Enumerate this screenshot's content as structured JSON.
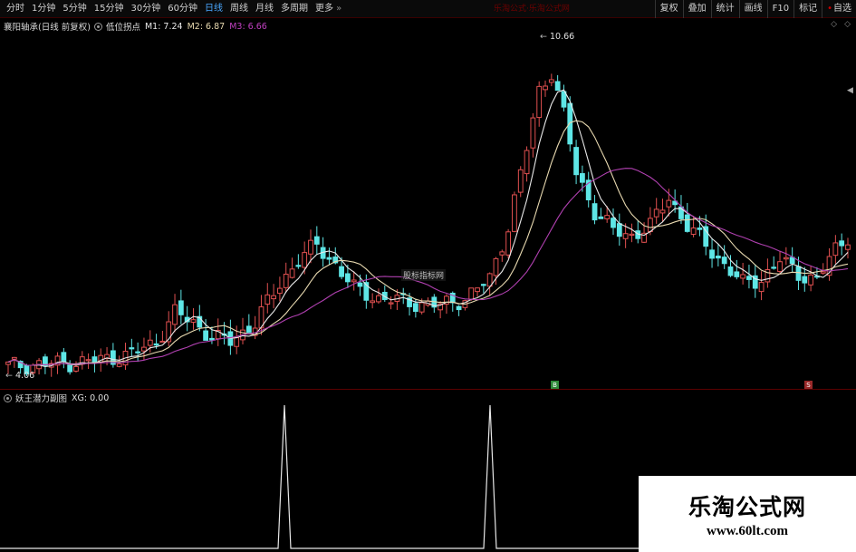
{
  "toolbar": {
    "periods": [
      {
        "label": "分时",
        "active": false
      },
      {
        "label": "1分钟",
        "active": false
      },
      {
        "label": "5分钟",
        "active": false
      },
      {
        "label": "15分钟",
        "active": false
      },
      {
        "label": "30分钟",
        "active": false
      },
      {
        "label": "60分钟",
        "active": false
      },
      {
        "label": "日线",
        "active": true
      },
      {
        "label": "周线",
        "active": false
      },
      {
        "label": "月线",
        "active": false
      },
      {
        "label": "多周期",
        "active": false
      },
      {
        "label": "更多",
        "active": false,
        "more": true
      }
    ],
    "center_text": "乐淘公式·乐淘公式网",
    "tools": [
      "复权",
      "叠加",
      "统计",
      "画线",
      "F10",
      "标记",
      "自选"
    ]
  },
  "main_chart": {
    "legend": {
      "name": "襄阳轴承(日线 前复权)",
      "formula": "低位拐点",
      "m1": "M1: 7.24",
      "m2": "M2: 6.87",
      "m3": "M3: 6.66"
    },
    "high_label": "10.66",
    "low_label": "4.06",
    "center_watermark": "股标指标网",
    "colors": {
      "up": "#e05050",
      "down": "#5ee6e6",
      "m1": "#e8e8e8",
      "m2": "#e8d9b0",
      "m3": "#b040b0"
    }
  },
  "sub_chart": {
    "name": "妖王潜力副图",
    "value": "XG: 0.00",
    "spikes": [
      0,
      1,
      0,
      1,
      0
    ]
  },
  "markers": {
    "buy": "B",
    "sell": "S"
  },
  "brand": {
    "title": "乐淘公式网",
    "url": "www.60lt.com"
  }
}
